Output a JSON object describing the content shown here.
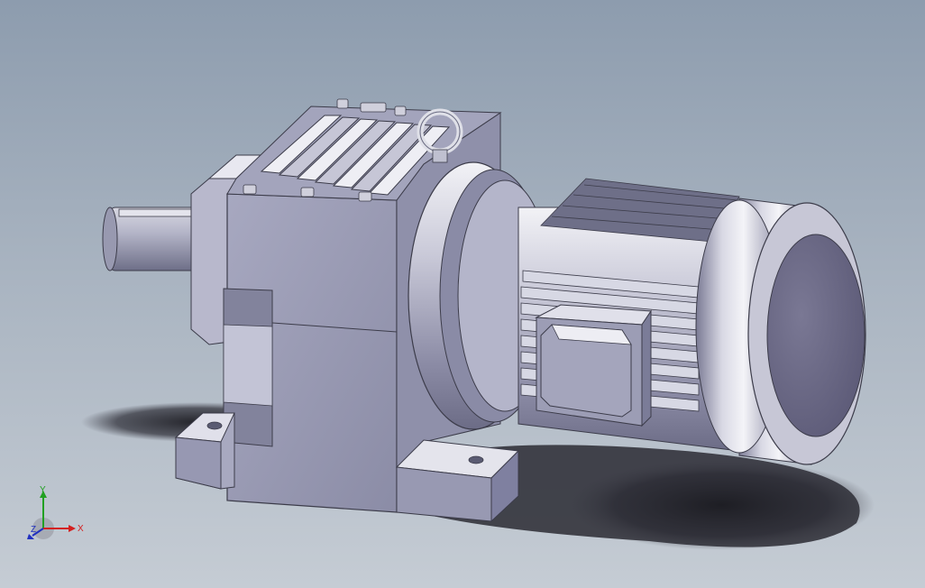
{
  "viewport": {
    "background_top": "#8d9cae",
    "background_bottom": "#c5ccd4"
  },
  "model": {
    "body_color": "#9a9cb4",
    "highlight_color": "#e6e6ee",
    "shadow_color": "#5f6075"
  },
  "triad": {
    "x_label": "X",
    "y_label": "Y",
    "z_label": "Z",
    "x_color": "#d42020",
    "y_color": "#22a022",
    "z_color": "#2030c0"
  }
}
